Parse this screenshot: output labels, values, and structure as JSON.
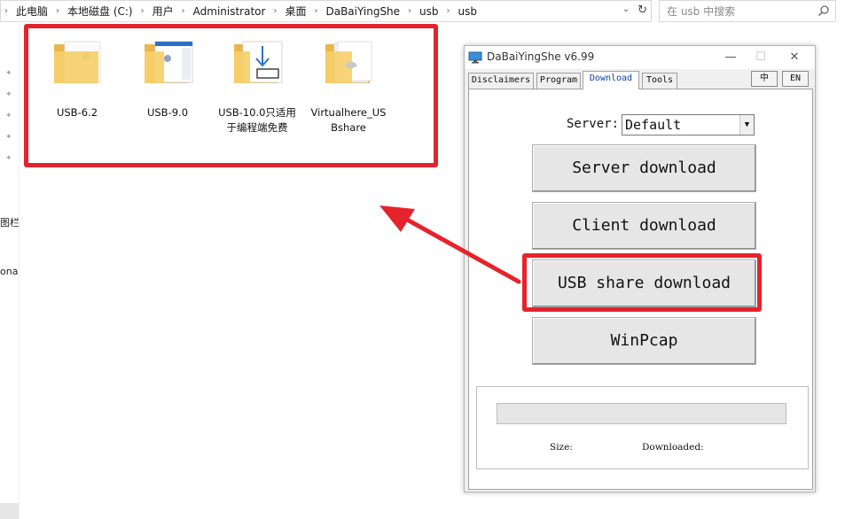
{
  "explorer": {
    "breadcrumb": [
      "此电脑",
      "本地磁盘 (C:)",
      "用户",
      "Administrator",
      "桌面",
      "DaBaiYingShe",
      "usb",
      "usb"
    ],
    "search_placeholder": "在 usb 中搜索",
    "nav_partial_labels": [
      "图栏",
      "ona"
    ],
    "folders": [
      {
        "name": "USB-6.2",
        "icon": "folder-with-app-icon"
      },
      {
        "name": "USB-9.0",
        "icon": "folder-with-app-icon"
      },
      {
        "name": "USB-10.0只适用于编程端免费",
        "icon": "folder-with-download-icon"
      },
      {
        "name": "Virtualhere_USBshare",
        "icon": "folder-with-document-icon"
      }
    ]
  },
  "app": {
    "title": "DaBaiYingShe v6.99",
    "tabs": [
      "Disclaimers",
      "Program",
      "Download",
      "Tools"
    ],
    "active_tab": "Download",
    "lang_buttons": [
      "中",
      "EN"
    ],
    "server_label": "Server:",
    "server_value": "Default",
    "buttons": [
      "Server download",
      "Client download",
      "USB share download",
      "WinPcap"
    ],
    "highlighted_button": "USB share download",
    "progress": 0,
    "size_label": "Size:",
    "downloaded_label": "Downloaded:"
  },
  "annotation": {
    "highlight_color": "#e5232c"
  }
}
